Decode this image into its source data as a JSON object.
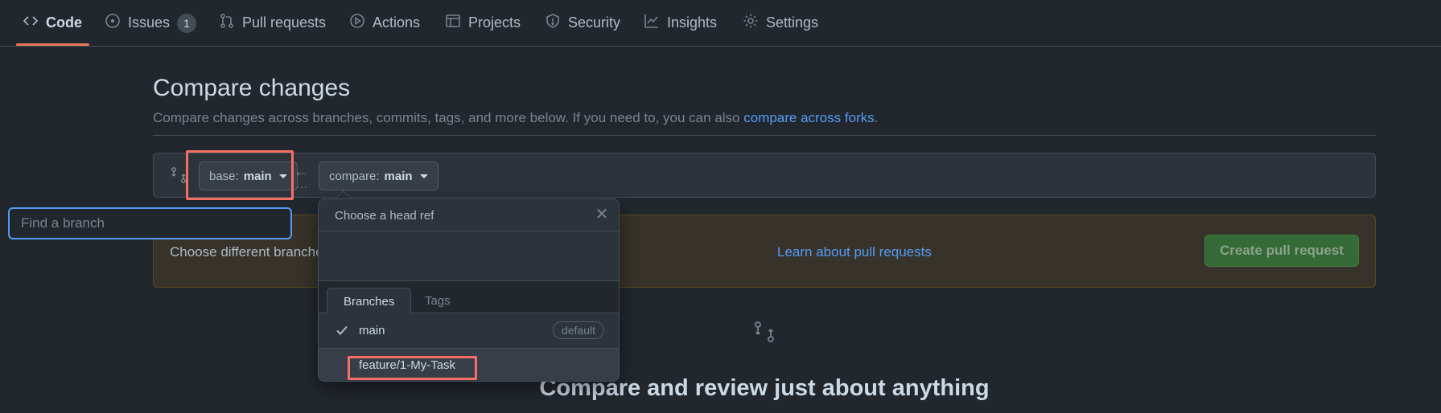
{
  "nav": {
    "tabs": [
      {
        "label": "Code",
        "icon": "code-icon"
      },
      {
        "label": "Issues",
        "icon": "issue-opened-icon",
        "count": "1"
      },
      {
        "label": "Pull requests",
        "icon": "git-pull-request-icon"
      },
      {
        "label": "Actions",
        "icon": "play-icon"
      },
      {
        "label": "Projects",
        "icon": "table-icon"
      },
      {
        "label": "Security",
        "icon": "shield-icon"
      },
      {
        "label": "Insights",
        "icon": "graph-icon"
      },
      {
        "label": "Settings",
        "icon": "gear-icon"
      }
    ],
    "accent": "#ec775c"
  },
  "header": {
    "title": "Compare changes",
    "subtitle": "Compare changes across branches, commits, tags, and more below. If you need to, you can also ",
    "subtitle_link": "compare across forks",
    "subtitle_end": "."
  },
  "range": {
    "base_prefix": "base:",
    "base_value": "main",
    "compare_prefix": "compare:",
    "compare_value": "main",
    "ellipsis": "..."
  },
  "flash": {
    "text": "Choose different branches or forks above to discuss and review changes.",
    "link": "Learn about pull requests",
    "button": "Create pull request"
  },
  "dropdown": {
    "title": "Choose a head ref",
    "filter_placeholder": "Find a branch",
    "tabs": [
      "Branches",
      "Tags"
    ],
    "items": [
      {
        "name": "main",
        "selected": true,
        "badge": "default"
      },
      {
        "name": "feature/1-My-Task",
        "selected": false
      }
    ]
  },
  "blankslate": {
    "title": "Compare and review just about anything"
  }
}
